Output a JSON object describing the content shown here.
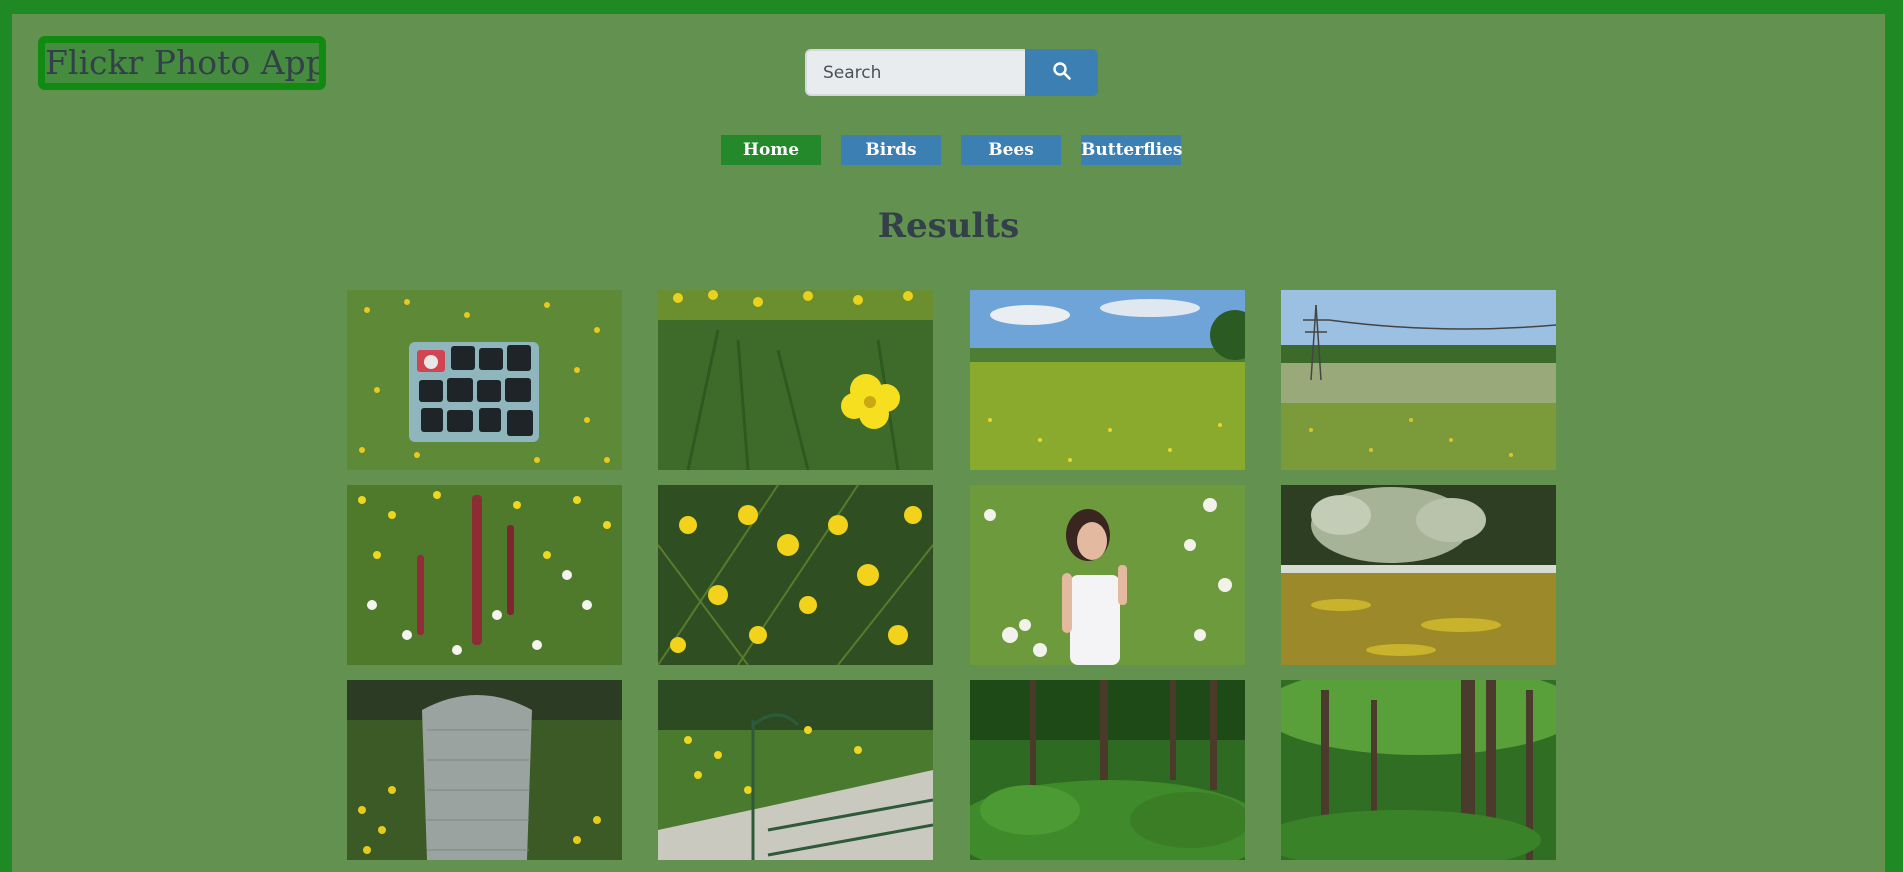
{
  "app": {
    "title": "Flickr Photo App"
  },
  "search": {
    "placeholder": "Search"
  },
  "nav": {
    "items": [
      "Home",
      "Birds",
      "Bees",
      "Butterflies"
    ],
    "active": "Home"
  },
  "results": {
    "title": "Results"
  },
  "colors": {
    "frame": "#1f8a24",
    "background": "#63914f",
    "logo_border": "#118a12",
    "nav_active": "#24892a",
    "nav_inactive": "#3c7fb3",
    "search_button": "#3c7fb3",
    "heading_text": "#333f49"
  },
  "photos": [
    {
      "subject": "cameras-on-tray-in-grass"
    },
    {
      "subject": "yellow-buttercup-closeup"
    },
    {
      "subject": "green-field-blue-sky"
    },
    {
      "subject": "field-with-power-pylon"
    },
    {
      "subject": "wildflower-meadow-red-sorrel"
    },
    {
      "subject": "buttercup-cluster"
    },
    {
      "subject": "woman-in-white-dress-in-meadow"
    },
    {
      "subject": "blossom-tree-over-golden-field"
    },
    {
      "subject": "wicker-chair-in-garden"
    },
    {
      "subject": "garden-gate-with-buttercups"
    },
    {
      "subject": "dense-green-woodland"
    },
    {
      "subject": "forest-tree-trunks"
    }
  ]
}
